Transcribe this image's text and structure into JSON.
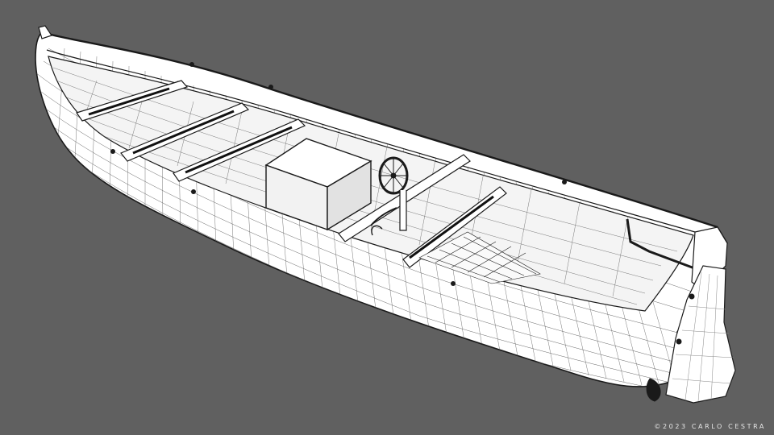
{
  "image": {
    "subject": "boat-wireframe-render",
    "background_color": "#606060",
    "hull_color": "#ffffff",
    "line_color": "#1a1a1a"
  },
  "credit": "©2023 CARLO CESTRA"
}
